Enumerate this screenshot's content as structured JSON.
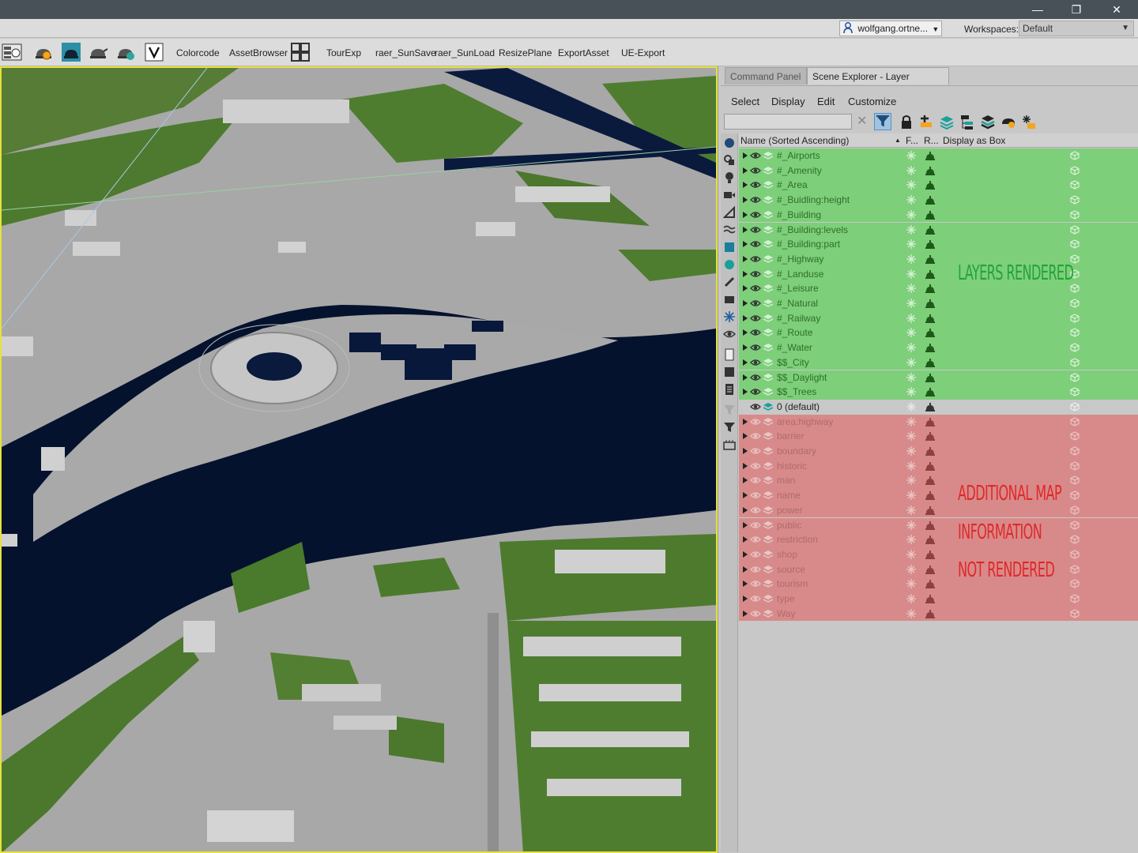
{
  "window": {
    "minimize_glyph": "—",
    "restore_glyph": "❐",
    "close_glyph": "✕"
  },
  "userbar": {
    "user": "wolfgang.ortne...",
    "workspaces_label": "Workspaces:",
    "workspace_value": "Default"
  },
  "toolbar": {
    "icons": [
      "scene-grid-icon",
      "teapot-settings-icon",
      "teapot-render-icon",
      "teapot-active-icon",
      "teapot-teal-icon",
      "filter-v-icon"
    ],
    "labels": {
      "colorcode": "Colorcode",
      "assetbrowser": "AssetBrowser",
      "tourexp": "TourExp",
      "sunsave": "raer_SunSave",
      "sunload": "raer_SunLoad",
      "resizeplane": "ResizePlane",
      "exportasset": "ExportAsset",
      "ueexport": "UE-Export"
    }
  },
  "panel": {
    "tabs": {
      "command": "Command Panel",
      "scene": "Scene Explorer - Layer Explorer"
    },
    "menu": {
      "select": "Select",
      "display": "Display",
      "edit": "Edit",
      "customize": "Customize"
    },
    "search_clear": "✕",
    "columns": {
      "name": "Name (Sorted Ascending)",
      "sort_arrow": "▲",
      "freeze": "F...",
      "render": "R...",
      "box": "Display as Box"
    },
    "rendered_layers": [
      "#_Airports",
      "#_Amenity",
      "#_Area",
      "#_Buidling:height",
      "#_Building",
      "#_Building:levels",
      "#_Building:part",
      "#_Highway",
      "#_Landuse",
      "#_Leisure",
      "#_Natural",
      "#_Railway",
      "#_Route",
      "#_Water",
      "$$_City",
      "$$_Daylight",
      "$$_Trees"
    ],
    "default_layer": "0 (default)",
    "unrendered_layers": [
      "area:highway",
      "barrier",
      "boundary",
      "historic",
      "man",
      "name",
      "power",
      "public",
      "restriction",
      "shop",
      "source",
      "tourism",
      "type",
      "Way"
    ]
  },
  "annotations": {
    "rendered": "LAYERS RENDERED",
    "not_rendered_1": "ADDITIONAL MAP",
    "not_rendered_2": "INFORMATION",
    "not_rendered_3": "NOT RENDERED"
  },
  "colors": {
    "rendered_row": "#7dcf7a",
    "unrendered_row": "#d88a8a",
    "viewport_border": "#e5e23c",
    "water": "#04122e",
    "grass": "#4f7a2e"
  }
}
